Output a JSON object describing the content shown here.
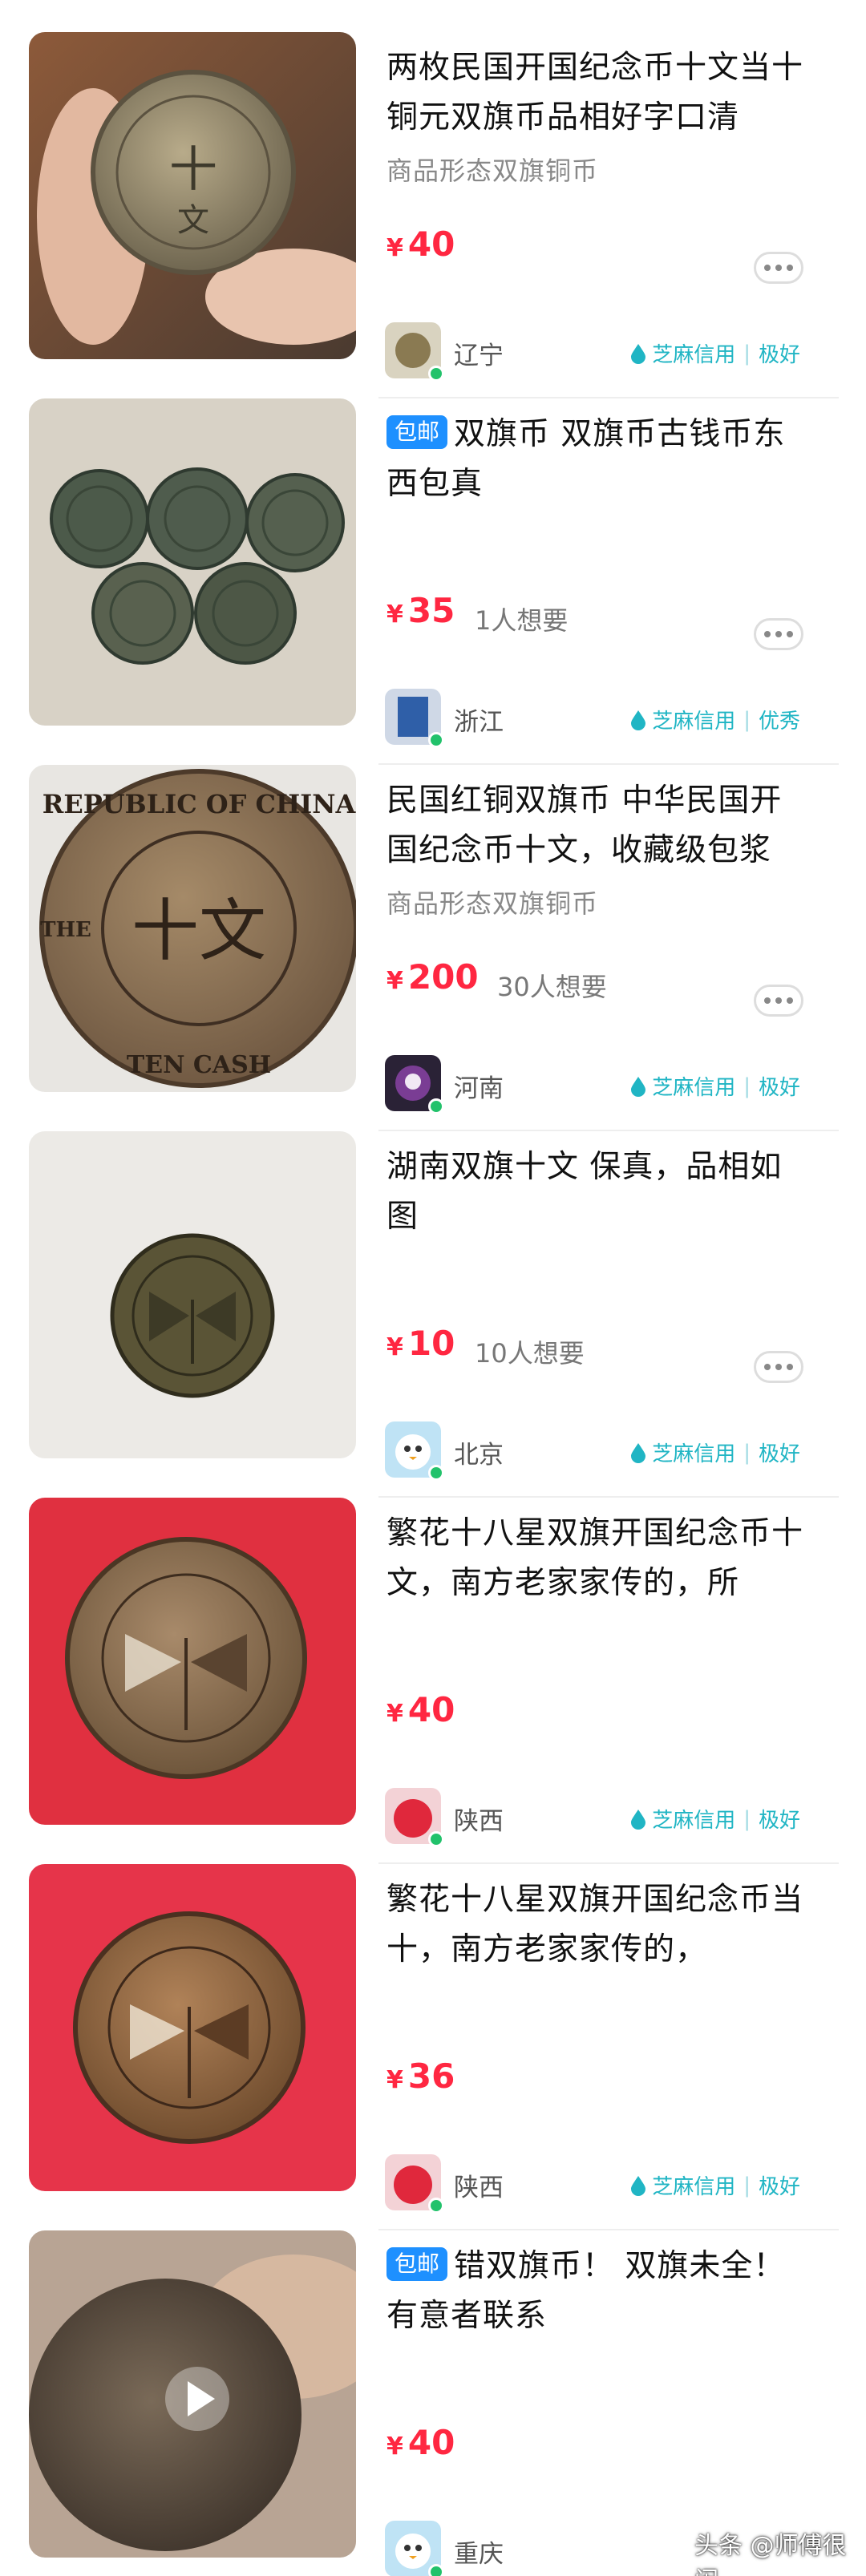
{
  "items": [
    {
      "title": "两枚民国开国纪念币十文当十铜元双旗币品相好字口清",
      "subtitle": "商品形态双旗铜币",
      "price_currency": "¥",
      "price": "40",
      "wants": "",
      "location": "辽宁",
      "credit_label": "芝麻信用",
      "credit_sep": "|",
      "credit_level": "极好"
    },
    {
      "tag": "包邮",
      "title": "双旗币 双旗币古钱币东西包真",
      "subtitle": "",
      "price_currency": "¥",
      "price": "35",
      "wants": "1人想要",
      "location": "浙江",
      "credit_label": "芝麻信用",
      "credit_sep": "|",
      "credit_level": "优秀"
    },
    {
      "title": "民国红铜双旗币 中华民国开国纪念币十文，收藏级包浆",
      "subtitle": "商品形态双旗铜币",
      "price_currency": "¥",
      "price": "200",
      "wants": "30人想要",
      "location": "河南",
      "credit_label": "芝麻信用",
      "credit_sep": "|",
      "credit_level": "极好"
    },
    {
      "title": "湖南双旗十文 保真，品相如图",
      "subtitle": "",
      "price_currency": "¥",
      "price": "10",
      "wants": "10人想要",
      "location": "北京",
      "credit_label": "芝麻信用",
      "credit_sep": "|",
      "credit_level": "极好"
    },
    {
      "title": "繁花十八星双旗开国纪念币十文，南方老家家传的，所",
      "subtitle": "",
      "price_currency": "¥",
      "price": "40",
      "wants": "",
      "location": "陕西",
      "credit_label": "芝麻信用",
      "credit_sep": "|",
      "credit_level": "极好"
    },
    {
      "title": "繁花十八星双旗开国纪念币当十，南方老家家传的，",
      "subtitle": "",
      "price_currency": "¥",
      "price": "36",
      "wants": "",
      "location": "陕西",
      "credit_label": "芝麻信用",
      "credit_sep": "|",
      "credit_level": "极好"
    },
    {
      "tag": "包邮",
      "title": "错双旗币！ 双旗未全！有意者联系",
      "subtitle": "",
      "price_currency": "¥",
      "price": "40",
      "wants": "",
      "location": "重庆",
      "credit_label": "",
      "credit_sep": "",
      "credit_level": ""
    }
  ],
  "coin3": {
    "top_text": "REPUBLIC OF CHINA",
    "bottom_text": "TEN CASH",
    "center_text": "十文",
    "left_text": "THE"
  },
  "watermark": "头条 @师傅很闲",
  "colors": {
    "price": "#ff2741",
    "credit": "#20b5c4",
    "tag": "#1e90ff",
    "online": "#22c26b"
  }
}
